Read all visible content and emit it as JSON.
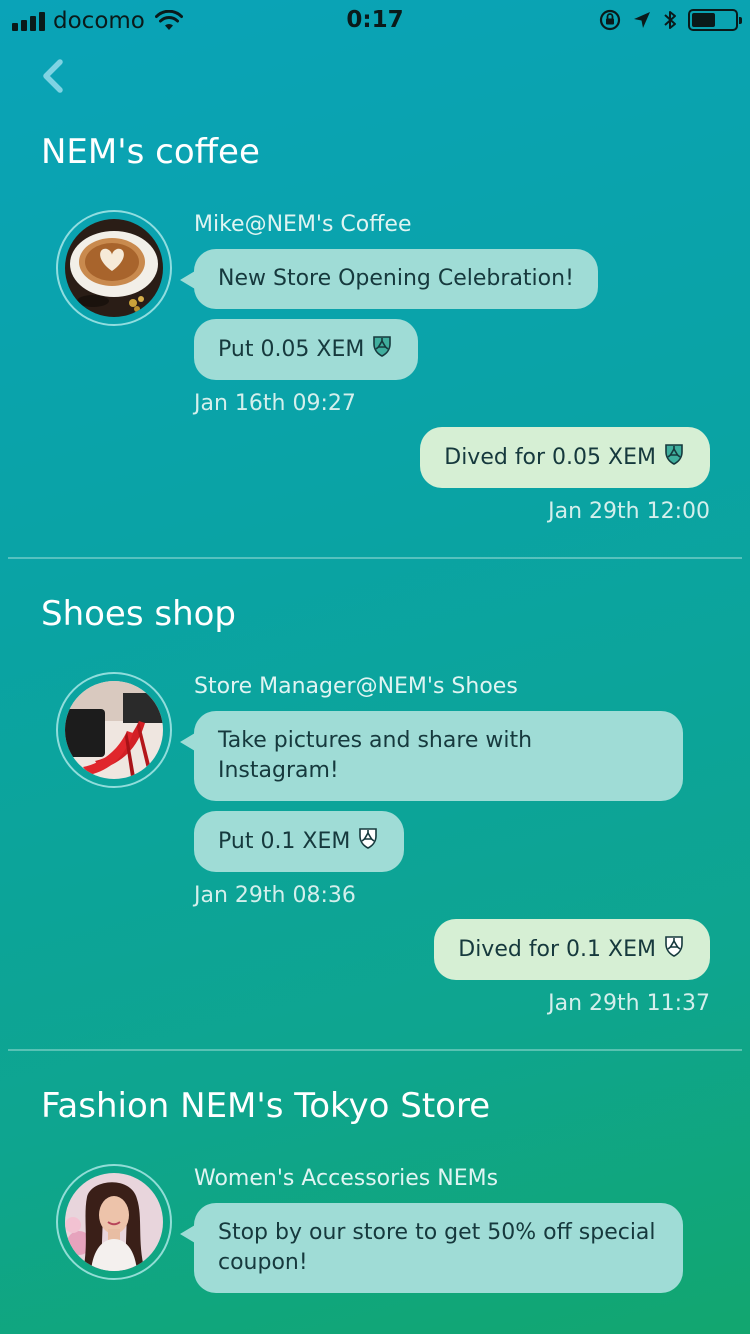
{
  "status_bar": {
    "carrier": "docomo",
    "time": "0:17",
    "battery_level": 0.55
  },
  "sections": [
    {
      "title": "NEM's coffee",
      "sender": "Mike@NEM's Coffee",
      "message": "New Store Opening Celebration!",
      "put_amount": "Put 0.05 XEM",
      "received_time": "Jan 16th 09:27",
      "dived_label": "Dived for 0.05 XEM",
      "dived_time": "Jan 29th 12:00"
    },
    {
      "title": "Shoes shop",
      "sender": "Store Manager@NEM's Shoes",
      "message": "Take pictures and share with Instagram!",
      "put_amount": "Put 0.1 XEM",
      "received_time": "Jan 29th 08:36",
      "dived_label": "Dived for 0.1 XEM",
      "dived_time": "Jan 29th 11:37"
    },
    {
      "title": "Fashion NEM's Tokyo Store",
      "sender": "Women's Accessories NEMs",
      "message": "Stop by our store to get 50% off special coupon!"
    }
  ],
  "icons": {
    "back": "chevron-left-icon",
    "currency": "xem-icon"
  },
  "colors": {
    "accent_back": "#7fd3e3",
    "received_bubble": "#9fdcd6",
    "sent_bubble": "#d6efd4"
  }
}
